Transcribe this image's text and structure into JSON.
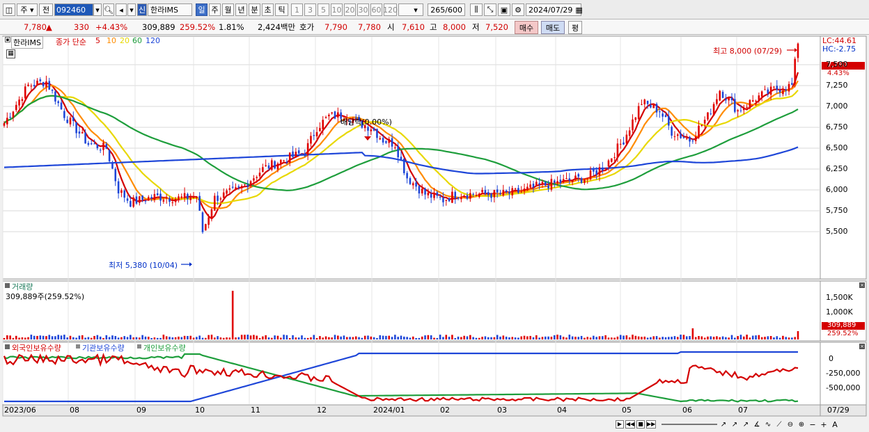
{
  "toolbar": {
    "period_day": "주",
    "prev_btn": "전",
    "code": "092460",
    "new_badge": "신",
    "name": "한라IMS",
    "tabs": [
      "일",
      "주",
      "월",
      "년",
      "분",
      "초",
      "틱"
    ],
    "active_tab": "일",
    "intervals": [
      "1",
      "3",
      "5",
      "10",
      "20",
      "30",
      "60",
      "120"
    ],
    "count": "265",
    "count_total": "/600",
    "date": "2024/07/29"
  },
  "quote": {
    "price": "7,780",
    "arrow": "▲",
    "change": "330",
    "change_pct": "+4.43%",
    "volume": "309,889",
    "volume_ratio": "259.52%",
    "turnover_pct": "1.81%",
    "amount": "2,424백만",
    "bid_label": "호가",
    "bid1": "7,790",
    "bid2": "7,780",
    "open_label": "시",
    "open": "7,610",
    "high_label": "고",
    "high": "8,000",
    "low_label": "저",
    "low": "7,520",
    "buy": "매수",
    "sell": "매도",
    "avg": "평"
  },
  "main_panel": {
    "stock_name": "한라IMS",
    "ma_label": "종가 단순",
    "ma_periods": [
      "5",
      "10",
      "20",
      "60",
      "120"
    ],
    "ma_colors": [
      "#d40000",
      "#ff8c00",
      "#e8d800",
      "#1e9e3c",
      "#1e46d8"
    ],
    "lc": "LC:44.61",
    "hc": "HC:-2.75",
    "price_tag": "7,780",
    "pct_tag": "4.43%",
    "y_ticks": [
      "7,500",
      "7,250",
      "7,000",
      "6,750",
      "6,500",
      "6,250",
      "6,000",
      "5,750",
      "5,500"
    ],
    "high_note": "최고 8,000 (07/29)",
    "low_note": "최저 5,380 (10/04)",
    "dividend_note": "배당락(0.00%)"
  },
  "volume_panel": {
    "title": "거래량",
    "value": "309,889주(259.52%)",
    "y_ticks": [
      "1,500K",
      "1,000K"
    ],
    "tag_value": "309,889",
    "tag_pct": "259.52%"
  },
  "holders_panel": {
    "series": [
      "외국인보유수량",
      "기관보유수량",
      "개인보유수량"
    ],
    "series_colors": [
      "#d40000",
      "#1e46d8",
      "#1e9e3c"
    ],
    "y_ticks": [
      "0",
      "-250,000",
      "-500,000"
    ]
  },
  "x_axis": {
    "labels": [
      "2023/06",
      "08",
      "09",
      "10",
      "11",
      "12",
      "2024/01",
      "02",
      "03",
      "04",
      "05",
      "06",
      "07"
    ],
    "right_label": "07/29"
  },
  "chart_data": {
    "type": "candlestick",
    "title": "한라IMS",
    "high": {
      "value": 8000,
      "date": "07/29"
    },
    "low": {
      "value": 5380,
      "date": "10/04"
    },
    "ylim": [
      5380,
      8000
    ],
    "last": 7780
  }
}
